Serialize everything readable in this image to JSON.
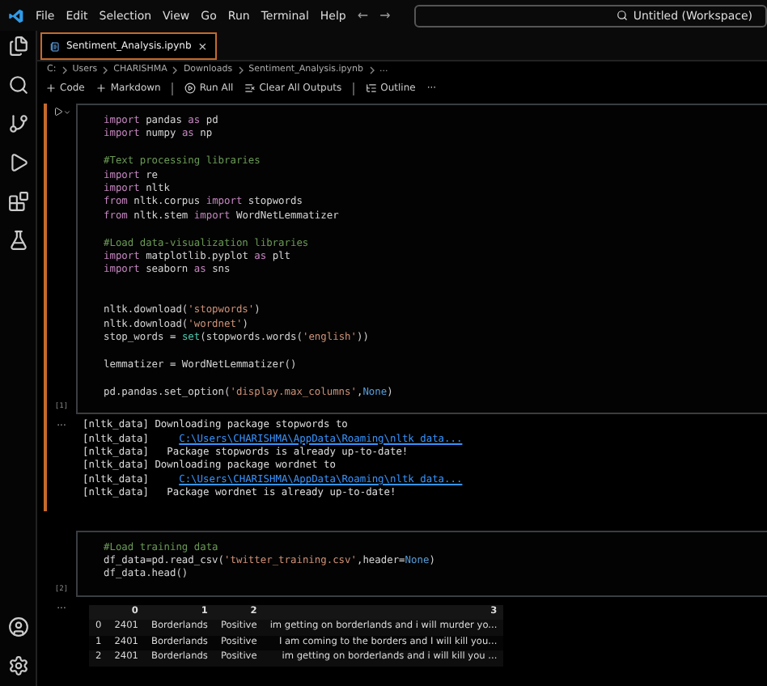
{
  "menu": [
    "File",
    "Edit",
    "Selection",
    "View",
    "Go",
    "Run",
    "Terminal",
    "Help"
  ],
  "nav_arrows": [
    "←",
    "→"
  ],
  "command_center": "Untitled (Workspace)",
  "tabs": [
    {
      "label": "Sentiment_Analysis.ipynb",
      "selected": true,
      "close": "×"
    }
  ],
  "breadcrumbs": [
    "C:",
    "Users",
    "CHARISHMA",
    "Downloads",
    "Sentiment_Analysis.ipynb",
    "..."
  ],
  "toolbar": [
    {
      "kind": "plus",
      "label": "Code"
    },
    {
      "kind": "plus",
      "label": "Markdown"
    },
    {
      "kind": "divider"
    },
    {
      "kind": "run",
      "label": "Run All"
    },
    {
      "kind": "clear",
      "label": "Clear All Outputs"
    },
    {
      "kind": "divider"
    },
    {
      "kind": "outline",
      "label": "Outline"
    },
    {
      "kind": "more",
      "label": "···"
    }
  ],
  "cells": [
    {
      "kind": "code",
      "selected": true,
      "count": "[1]",
      "lines": [
        {
          "kind": "code",
          "tokens": [
            {
              "kind": "keyword",
              "text": "import"
            },
            {
              "kind": "plain",
              "text": " pandas "
            },
            {
              "kind": "keyword",
              "text": "as"
            },
            {
              "kind": "plain",
              "text": " pd"
            }
          ]
        },
        {
          "kind": "code",
          "tokens": [
            {
              "kind": "keyword",
              "text": "import"
            },
            {
              "kind": "plain",
              "text": " numpy "
            },
            {
              "kind": "keyword",
              "text": "as"
            },
            {
              "kind": "plain",
              "text": " np"
            }
          ]
        },
        {
          "kind": "blank"
        },
        {
          "kind": "code",
          "tokens": [
            {
              "kind": "comment",
              "text": "#Text processing libraries"
            }
          ]
        },
        {
          "kind": "code",
          "tokens": [
            {
              "kind": "keyword",
              "text": "import"
            },
            {
              "kind": "plain",
              "text": " re"
            }
          ]
        },
        {
          "kind": "code",
          "tokens": [
            {
              "kind": "keyword",
              "text": "import"
            },
            {
              "kind": "plain",
              "text": " nltk"
            }
          ]
        },
        {
          "kind": "code",
          "tokens": [
            {
              "kind": "keyword",
              "text": "from"
            },
            {
              "kind": "plain",
              "text": " nltk.corpus "
            },
            {
              "kind": "keyword",
              "text": "import"
            },
            {
              "kind": "plain",
              "text": " stopwords"
            }
          ]
        },
        {
          "kind": "code",
          "tokens": [
            {
              "kind": "keyword",
              "text": "from"
            },
            {
              "kind": "plain",
              "text": " nltk.stem "
            },
            {
              "kind": "keyword",
              "text": "import"
            },
            {
              "kind": "plain",
              "text": " WordNetLemmatizer"
            }
          ]
        },
        {
          "kind": "blank"
        },
        {
          "kind": "code",
          "tokens": [
            {
              "kind": "comment",
              "text": "#Load data-visualization libraries"
            }
          ]
        },
        {
          "kind": "code",
          "tokens": [
            {
              "kind": "keyword",
              "text": "import"
            },
            {
              "kind": "plain",
              "text": " matplotlib.pyplot "
            },
            {
              "kind": "keyword",
              "text": "as"
            },
            {
              "kind": "plain",
              "text": " plt"
            }
          ]
        },
        {
          "kind": "code",
          "tokens": [
            {
              "kind": "keyword",
              "text": "import"
            },
            {
              "kind": "plain",
              "text": " seaborn "
            },
            {
              "kind": "keyword",
              "text": "as"
            },
            {
              "kind": "plain",
              "text": " sns"
            }
          ]
        },
        {
          "kind": "blank"
        },
        {
          "kind": "blank"
        },
        {
          "kind": "code",
          "tokens": [
            {
              "kind": "plain",
              "text": "nltk.download("
            },
            {
              "kind": "string",
              "text": "'stopwords'"
            },
            {
              "kind": "plain",
              "text": ")"
            }
          ]
        },
        {
          "kind": "code",
          "tokens": [
            {
              "kind": "plain",
              "text": "nltk.download("
            },
            {
              "kind": "string",
              "text": "'wordnet'"
            },
            {
              "kind": "plain",
              "text": ")"
            }
          ]
        },
        {
          "kind": "code",
          "tokens": [
            {
              "kind": "plain",
              "text": "stop_words = "
            },
            {
              "kind": "builtin",
              "text": "set"
            },
            {
              "kind": "plain",
              "text": "(stopwords.words("
            },
            {
              "kind": "string",
              "text": "'english'"
            },
            {
              "kind": "plain",
              "text": "))"
            }
          ]
        },
        {
          "kind": "blank"
        },
        {
          "kind": "code",
          "tokens": [
            {
              "kind": "plain",
              "text": "lemmatizer = WordNetLemmatizer()"
            }
          ]
        },
        {
          "kind": "blank"
        },
        {
          "kind": "code",
          "tokens": [
            {
              "kind": "plain",
              "text": "pd.pandas.set_option("
            },
            {
              "kind": "string",
              "text": "'display.max_columns'"
            },
            {
              "kind": "plain",
              "text": ","
            },
            {
              "kind": "constant",
              "text": "None"
            },
            {
              "kind": "plain",
              "text": ")"
            }
          ]
        }
      ],
      "output": {
        "kind": "stream",
        "marker": "...",
        "lines": [
          {
            "text": "[nltk_data] Downloading package stopwords to"
          },
          {
            "text": "[nltk_data]     ",
            "link": "C:\\Users\\CHARISHMA\\AppData\\Roaming\\nltk_data..."
          },
          {
            "text": "[nltk_data]   Package stopwords is already up-to-date!"
          },
          {
            "text": "[nltk_data] Downloading package wordnet to"
          },
          {
            "text": "[nltk_data]     ",
            "link": "C:\\Users\\CHARISHMA\\AppData\\Roaming\\nltk_data..."
          },
          {
            "text": "[nltk_data]   Package wordnet is already up-to-date!"
          }
        ]
      }
    },
    {
      "kind": "code",
      "selected": false,
      "count": "[2]",
      "lines": [
        {
          "kind": "code",
          "tokens": [
            {
              "kind": "comment",
              "text": "#Load training data"
            }
          ]
        },
        {
          "kind": "code",
          "tokens": [
            {
              "kind": "plain",
              "text": "df_data=pd.read_csv("
            },
            {
              "kind": "string",
              "text": "'twitter_training.csv'"
            },
            {
              "kind": "plain",
              "text": ",header="
            },
            {
              "kind": "constant",
              "text": "None"
            },
            {
              "kind": "plain",
              "text": ")"
            }
          ]
        },
        {
          "kind": "code",
          "tokens": [
            {
              "kind": "plain",
              "text": "df_data.head()"
            }
          ]
        }
      ],
      "output": {
        "kind": "table",
        "marker": "...",
        "columns": [
          "0",
          "1",
          "2",
          "3"
        ],
        "rows": [
          {
            "index": "0",
            "cells": [
              "2401",
              "Borderlands",
              "Positive",
              "im getting on borderlands and i will murder yo..."
            ]
          },
          {
            "index": "1",
            "cells": [
              "2401",
              "Borderlands",
              "Positive",
              "I am coming to the borders and I will kill you..."
            ]
          },
          {
            "index": "2",
            "cells": [
              "2401",
              "Borderlands",
              "Positive",
              "im getting on borderlands and i will kill you ..."
            ]
          }
        ]
      }
    }
  ]
}
